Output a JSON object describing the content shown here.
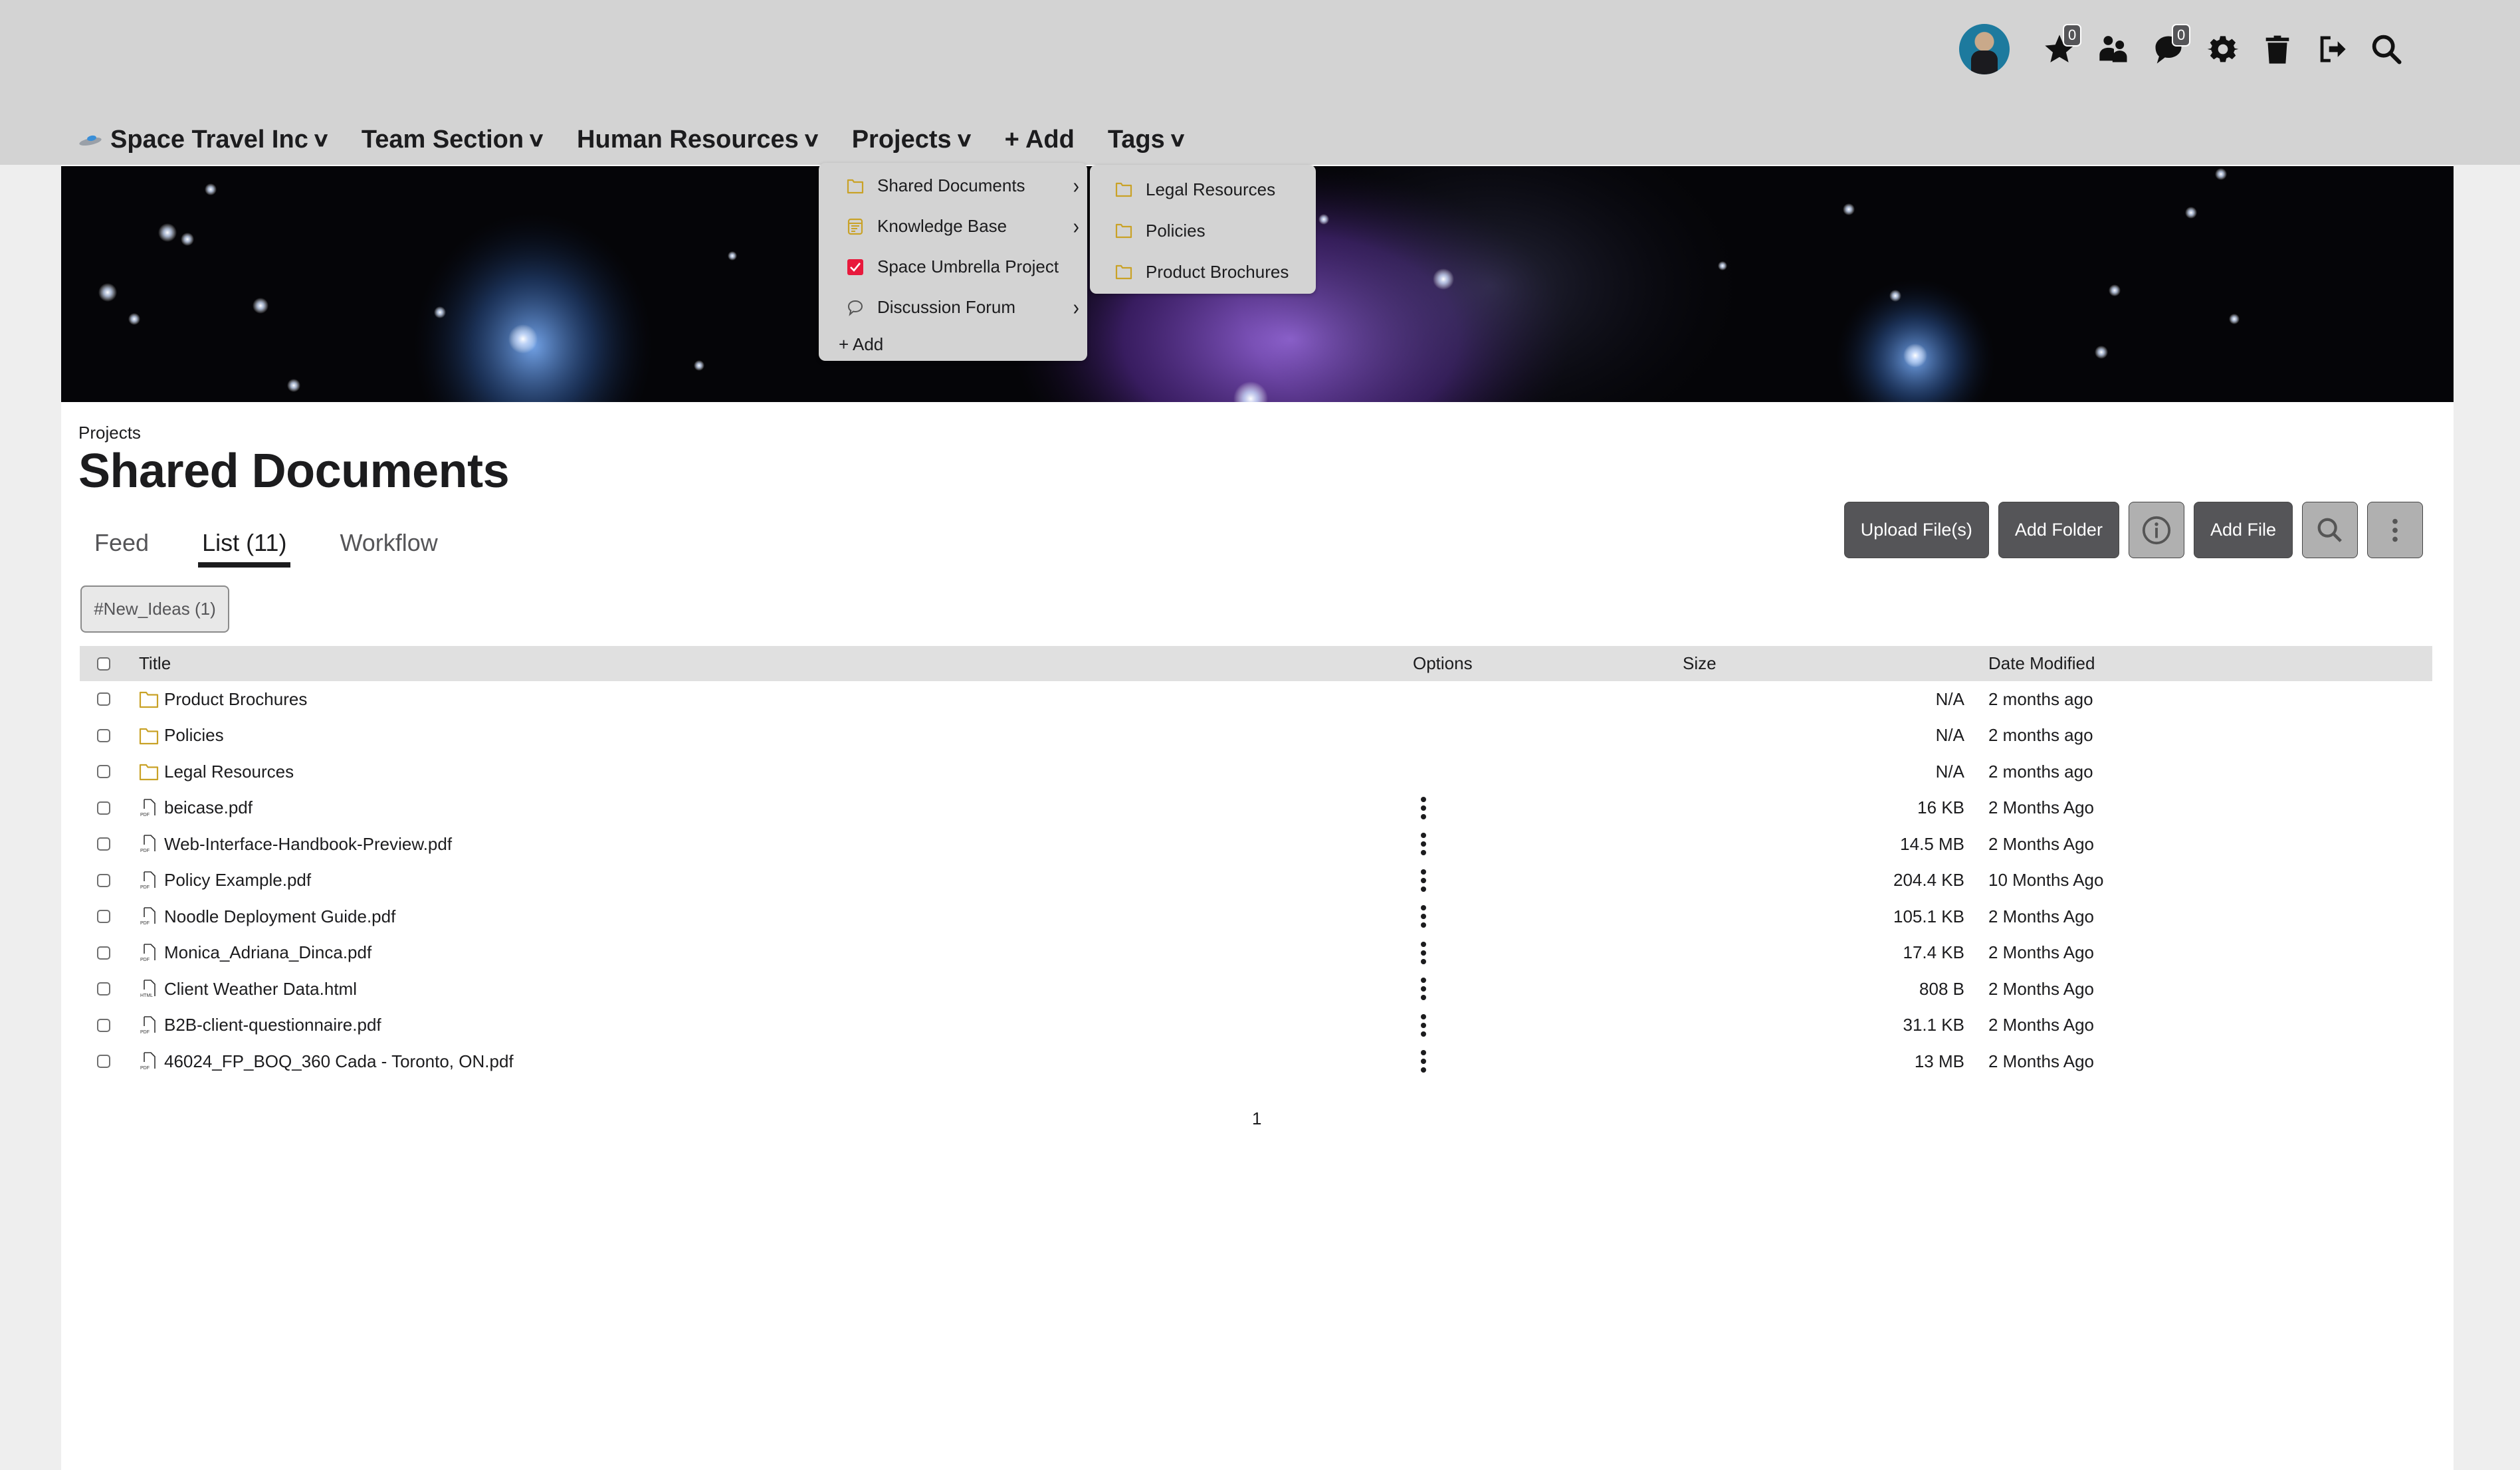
{
  "topbar": {
    "avatar_label": "User avatar",
    "icons": [
      {
        "name": "favorites",
        "icon": "star-icon",
        "badge": "0"
      },
      {
        "name": "people",
        "icon": "users-icon"
      },
      {
        "name": "messages",
        "icon": "chat-icon",
        "badge": "0"
      },
      {
        "name": "settings",
        "icon": "gear-icon"
      },
      {
        "name": "trash",
        "icon": "trash-icon"
      },
      {
        "name": "logout",
        "icon": "logout-icon"
      },
      {
        "name": "search",
        "icon": "search-icon"
      }
    ]
  },
  "nav": {
    "items": [
      {
        "label": "Space Travel Inc",
        "has_chevron": true
      },
      {
        "label": "Team Section",
        "has_chevron": true
      },
      {
        "label": "Human Resources",
        "has_chevron": true
      },
      {
        "label": "Projects",
        "has_chevron": true
      },
      {
        "label": "+ Add",
        "has_chevron": false
      },
      {
        "label": "Tags",
        "has_chevron": true
      }
    ]
  },
  "projects_menu": {
    "items": [
      {
        "label": "Shared Documents",
        "icon": "folder-icon",
        "has_submenu": true
      },
      {
        "label": "Knowledge Base",
        "icon": "knowledge-base-icon",
        "has_submenu": true
      },
      {
        "label": "Space Umbrella Project",
        "icon": "checkbox-checked-icon",
        "has_submenu": false
      },
      {
        "label": "Discussion Forum",
        "icon": "speech-bubble-icon",
        "has_submenu": true
      }
    ],
    "add_label": "+ Add"
  },
  "shared_docs_submenu": {
    "items": [
      {
        "label": "Legal Resources"
      },
      {
        "label": "Policies"
      },
      {
        "label": "Product Brochures"
      }
    ]
  },
  "page": {
    "breadcrumb": "Projects",
    "title": "Shared Documents",
    "tabs": [
      {
        "label": "Feed",
        "active": false
      },
      {
        "label": "List (11)",
        "active": true
      },
      {
        "label": "Workflow",
        "active": false
      }
    ],
    "tag_filter": "#New_Ideas (1)"
  },
  "toolbar": {
    "upload_label": "Upload File(s)",
    "add_folder_label": "Add Folder",
    "add_file_label": "Add File"
  },
  "table": {
    "headers": {
      "title": "Title",
      "options": "Options",
      "size": "Size",
      "date": "Date Modified"
    },
    "rows": [
      {
        "title": "Product Brochures",
        "type": "folder",
        "size": "N/A",
        "date": "2 months ago",
        "has_options": false
      },
      {
        "title": "Policies",
        "type": "folder",
        "size": "N/A",
        "date": "2 months ago",
        "has_options": false
      },
      {
        "title": "Legal Resources",
        "type": "folder",
        "size": "N/A",
        "date": "2 months ago",
        "has_options": false
      },
      {
        "title": "beicase.pdf",
        "type": "pdf",
        "size": "16 KB",
        "date": "2 Months Ago",
        "has_options": true
      },
      {
        "title": "Web-Interface-Handbook-Preview.pdf",
        "type": "pdf",
        "size": "14.5 MB",
        "date": "2 Months Ago",
        "has_options": true
      },
      {
        "title": "Policy Example.pdf",
        "type": "pdf",
        "size": "204.4 KB",
        "date": "10 Months Ago",
        "has_options": true
      },
      {
        "title": "Noodle Deployment Guide.pdf",
        "type": "pdf",
        "size": "105.1 KB",
        "date": "2 Months Ago",
        "has_options": true
      },
      {
        "title": "Monica_Adriana_Dinca.pdf",
        "type": "pdf",
        "size": "17.4 KB",
        "date": "2 Months Ago",
        "has_options": true
      },
      {
        "title": "Client Weather Data.html",
        "type": "html",
        "size": "808 B",
        "date": "2 Months Ago",
        "has_options": true
      },
      {
        "title": "B2B-client-questionnaire.pdf",
        "type": "pdf",
        "size": "31.1 KB",
        "date": "2 Months Ago",
        "has_options": true
      },
      {
        "title": "46024_FP_BOQ_360 Cada - Toronto, ON.pdf",
        "type": "pdf",
        "size": "13 MB",
        "date": "2 Months Ago",
        "has_options": true
      }
    ]
  },
  "pagination": {
    "current_page": "1"
  },
  "colors": {
    "topbar_bg": "#d3d3d3",
    "page_bg": "#eeeeee",
    "folder_icon": "#c9a227",
    "dark_button": "#555558",
    "light_button": "#b0b0b0",
    "checked_red": "#e8193c",
    "table_header_bg": "#e0e0e0"
  }
}
